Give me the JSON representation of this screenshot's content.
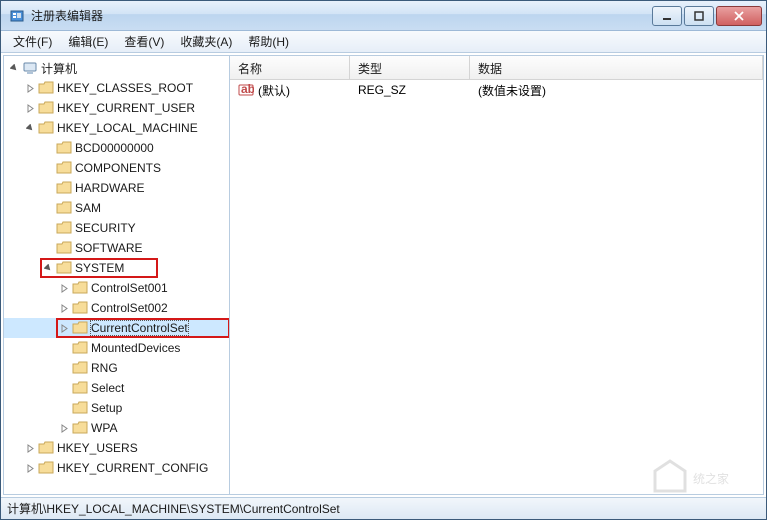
{
  "window": {
    "title": "注册表编辑器"
  },
  "menu": {
    "file": "文件(F)",
    "edit": "编辑(E)",
    "view": "查看(V)",
    "favorites": "收藏夹(A)",
    "help": "帮助(H)"
  },
  "tree": {
    "root": "计算机",
    "hkcr": "HKEY_CLASSES_ROOT",
    "hkcu": "HKEY_CURRENT_USER",
    "hklm": "HKEY_LOCAL_MACHINE",
    "hklm_children": {
      "bcd": "BCD00000000",
      "components": "COMPONENTS",
      "hardware": "HARDWARE",
      "sam": "SAM",
      "security": "SECURITY",
      "software": "SOFTWARE",
      "system": "SYSTEM"
    },
    "system_children": {
      "cs001": "ControlSet001",
      "cs002": "ControlSet002",
      "ccs": "CurrentControlSet",
      "mounted": "MountedDevices",
      "rng": "RNG",
      "select": "Select",
      "setup": "Setup",
      "wpa": "WPA"
    },
    "hku": "HKEY_USERS",
    "hkcc": "HKEY_CURRENT_CONFIG"
  },
  "list": {
    "columns": {
      "name": "名称",
      "type": "类型",
      "data": "数据"
    },
    "rows": [
      {
        "name": "(默认)",
        "type": "REG_SZ",
        "data": "(数值未设置)"
      }
    ]
  },
  "status": {
    "path": "计算机\\HKEY_LOCAL_MACHINE\\SYSTEM\\CurrentControlSet"
  }
}
